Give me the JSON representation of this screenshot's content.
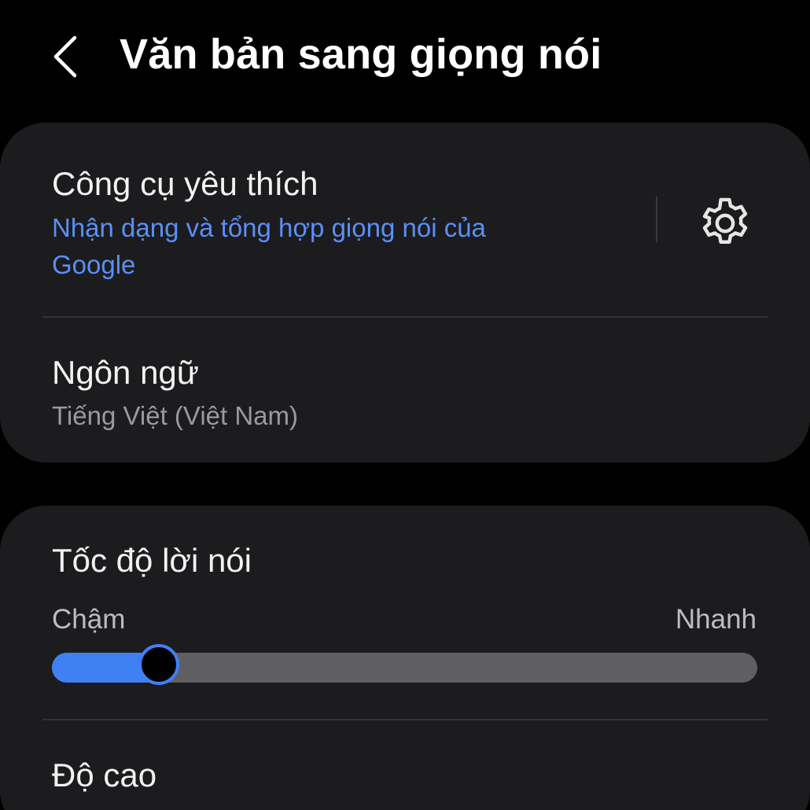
{
  "header": {
    "title": "Văn bản sang giọng nói",
    "back_icon": "chevron-left-icon"
  },
  "card_engine": {
    "preferred_engine": {
      "title": "Công cụ yêu thích",
      "value": "Nhận dạng và tổng hợp giọng nói của Google",
      "settings_icon": "gear-icon"
    },
    "language": {
      "title": "Ngôn ngữ",
      "value": "Tiếng Việt (Việt Nam)"
    }
  },
  "card_speech": {
    "speech_rate": {
      "title": "Tốc độ lời nói",
      "min_label": "Chậm",
      "max_label": "Nhanh",
      "value_fraction": 0.152
    },
    "pitch": {
      "title": "Độ cao"
    }
  },
  "colors": {
    "background": "#000000",
    "card": "#1c1c1e",
    "accent": "#3f80f4",
    "link_text": "#5b8ff5",
    "secondary_text": "#9a9a9e",
    "track": "#5f5f62"
  }
}
